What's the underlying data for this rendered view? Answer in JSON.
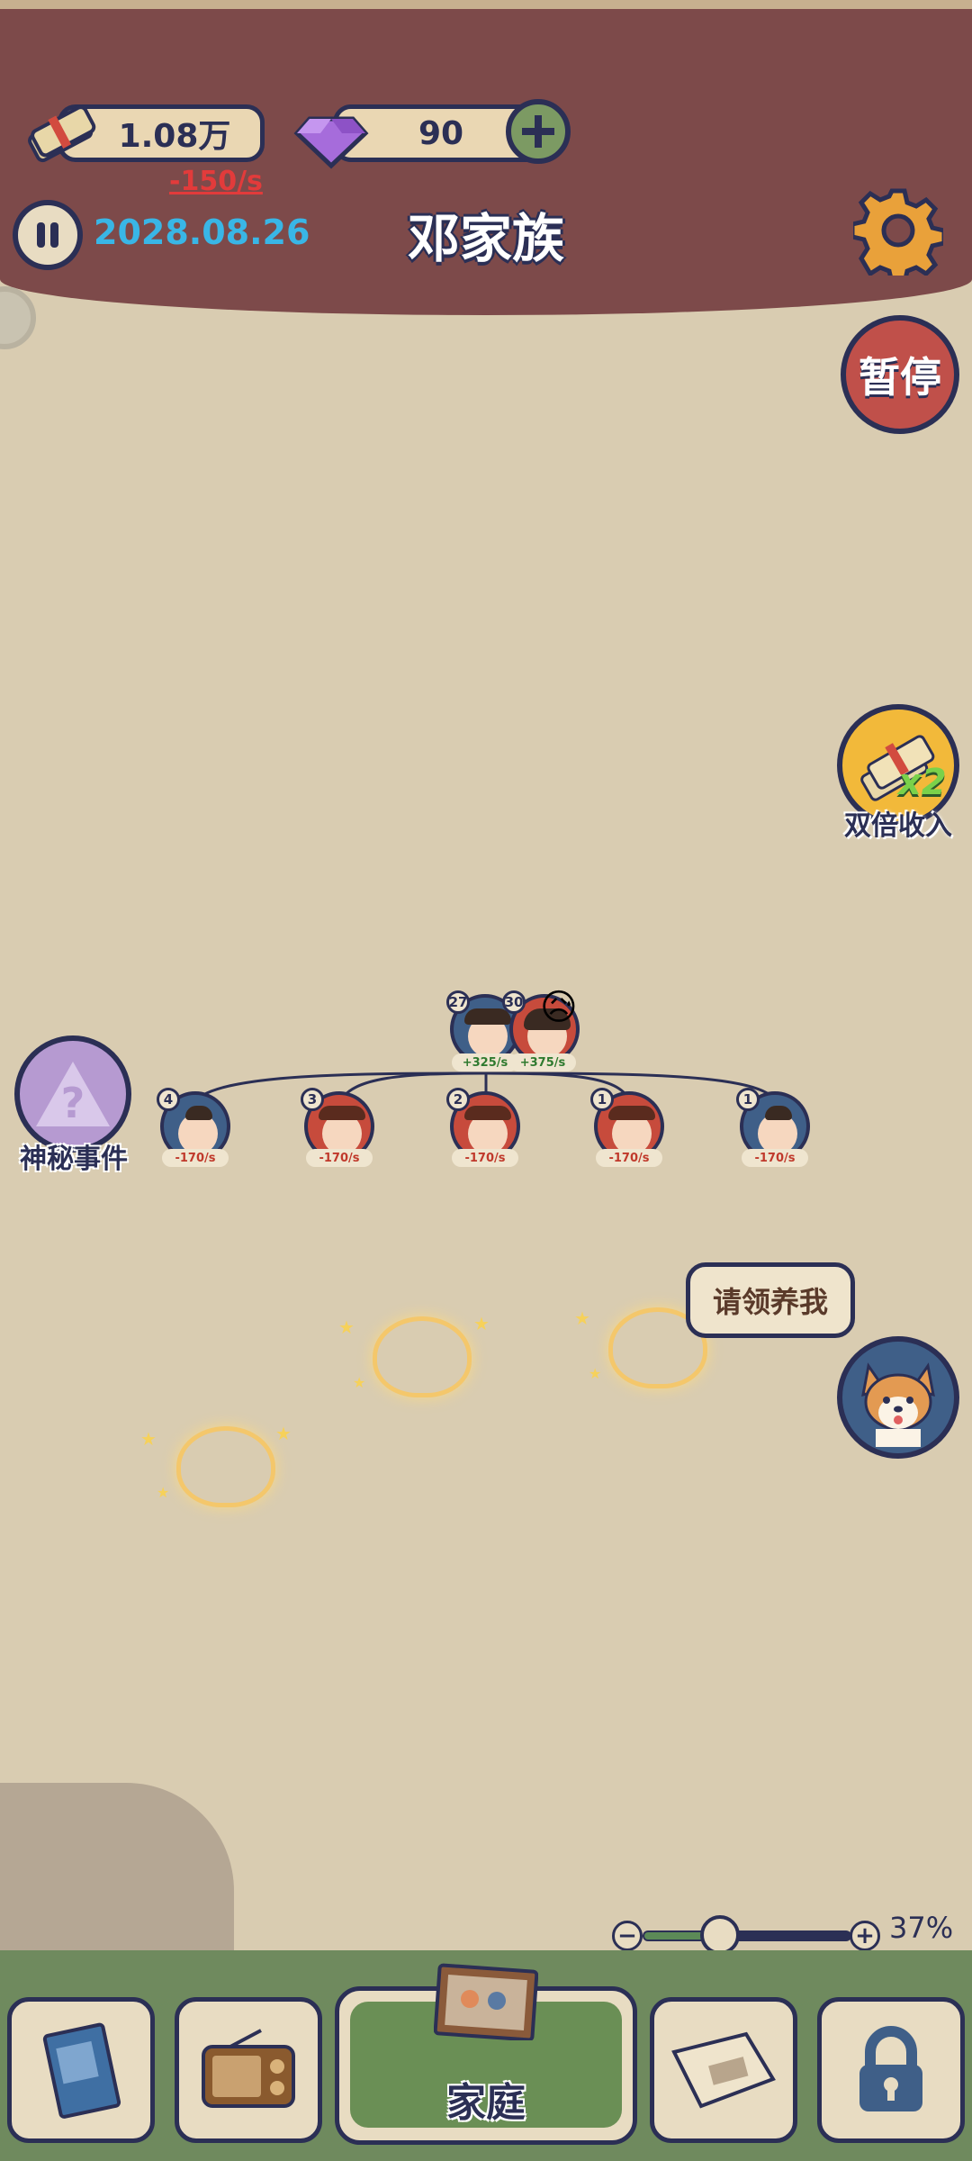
{
  "header": {
    "money": "1.08万",
    "money_rate": "-150/s",
    "gems": "90",
    "date": "2028.08.26",
    "family_name": "邓家族"
  },
  "side_buttons": {
    "pause_label": "暂停",
    "double_income_label": "双倍收入",
    "double_badge": "x2",
    "mystery_label": "神秘事件",
    "mystery_symbol": "?"
  },
  "tree": {
    "parents": [
      {
        "age": "27",
        "rate": "+325/s",
        "gender": "male"
      },
      {
        "age": "30",
        "rate": "+375/s",
        "gender": "female",
        "mood": "😥"
      }
    ],
    "children": [
      {
        "age": "4",
        "rate": "-170/s",
        "gender": "male"
      },
      {
        "age": "3",
        "rate": "-170/s",
        "gender": "female"
      },
      {
        "age": "2",
        "rate": "-170/s",
        "gender": "female"
      },
      {
        "age": "1",
        "rate": "-170/s",
        "gender": "female"
      },
      {
        "age": "1",
        "rate": "-170/s",
        "gender": "male"
      }
    ]
  },
  "pet": {
    "speech": "请领养我"
  },
  "zoom": {
    "minus": "−",
    "plus": "+",
    "value": "37%",
    "level": 0.37
  },
  "bottom_tabs": [
    {
      "icon": "book-icon"
    },
    {
      "icon": "radio-icon"
    },
    {
      "icon": "family-photo-icon",
      "label": "家庭"
    },
    {
      "icon": "map-scroll-icon"
    },
    {
      "icon": "lock-icon"
    }
  ],
  "colors": {
    "header_bg": "#7d4a4a",
    "navy": "#2b2f55",
    "date_blue": "#39b6e6",
    "pause_red": "#c0504a",
    "mystery_purple": "#b69ad1",
    "slider_green": "#5c8a57"
  }
}
